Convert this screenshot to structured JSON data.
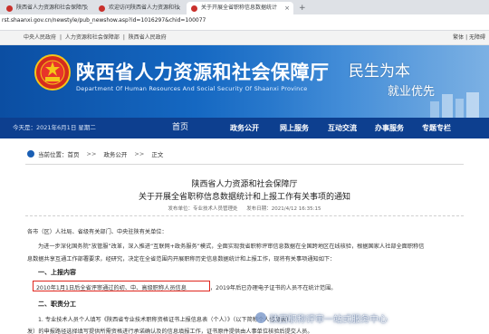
{
  "browser": {
    "tabs": [
      {
        "label": "陕西省人力资源和社会保障厅",
        "active": false
      },
      {
        "label": "欢迎访问陕西省人力资源和社",
        "active": false
      },
      {
        "label": "关于开展全省职称信息数据统计",
        "active": true
      }
    ],
    "new_tab": "+",
    "close": "×",
    "url": "rst.shaanxi.gov.cn/newstyle/pub_newshow.asp?id=1016297&chid=100077"
  },
  "toplinks": {
    "items": [
      "中央人民政府",
      "|",
      "人力资源和社会保障部",
      "|",
      "陕西省人民政府"
    ],
    "right": "繁体 | 无障碍"
  },
  "banner": {
    "title": "陕西省人力资源和社会保障厅",
    "subtitle": "Department Of Human Resources And Social Security Of Shaanxi Province",
    "slogan1": "民生为本",
    "slogan2": "就业优先",
    "colors": {
      "primary": "#0b4ea2",
      "nav": "#0d3f8f",
      "highlight": "#e0261d"
    }
  },
  "nav": {
    "date": "今天是：2021年6月1日 星期二",
    "home": "首页",
    "items": [
      "政务公开",
      "网上服务",
      "互动交流",
      "办事服务",
      "专题专栏"
    ]
  },
  "breadcrumb": {
    "label": "当前位置：",
    "items": [
      "首页",
      "政务公开",
      "正文"
    ],
    "sep": ">>"
  },
  "article": {
    "title1": "陕西省人力资源和社会保障厅",
    "title2": "关于开展全省职称信息数据统计和上报工作有关事项的通知",
    "meta_source": "发布单位：专业技术人员管理处",
    "meta_date": "发布日期：2021/4/12 16:35:15",
    "addressee": "各市（区）人社局、省级有关部门、中央驻陕有关单位：",
    "p1_line1": "为进一步深化国务院“放管服”改革，深入推进“互联网+政务服务”模式，全面实现我省职称评审信息数据在全国跨地区在线核验，根据国家人社部全面职称信",
    "p1_line2": "息数据共享互通工作部署要求，经研究，决定在全省范围内开展职称历史信息数据统计和上报工作，现将有关事项通知如下：",
    "s1": "一、上报内容",
    "s1_highlight": "2010年1月1日后全省评审通过的初、中、高级职称人员信息",
    "s1_rest": "，2019年后已办理电子证书的人员不在统计范围。",
    "s2": "二、职责分工",
    "p2_line1": "1. 专业技术人员个人填写《陕西省专业技术职称资格证书上报信息表（个人）》（以下简称个人信息表），",
    "p2_line2": "发）的申报路径选择填写提供所需资格进行承诺确认及的信息填报工作，证书原件提供由人事单位核验后提交人员。"
  },
  "watermark": "陕西职称评审一站式服务中心"
}
